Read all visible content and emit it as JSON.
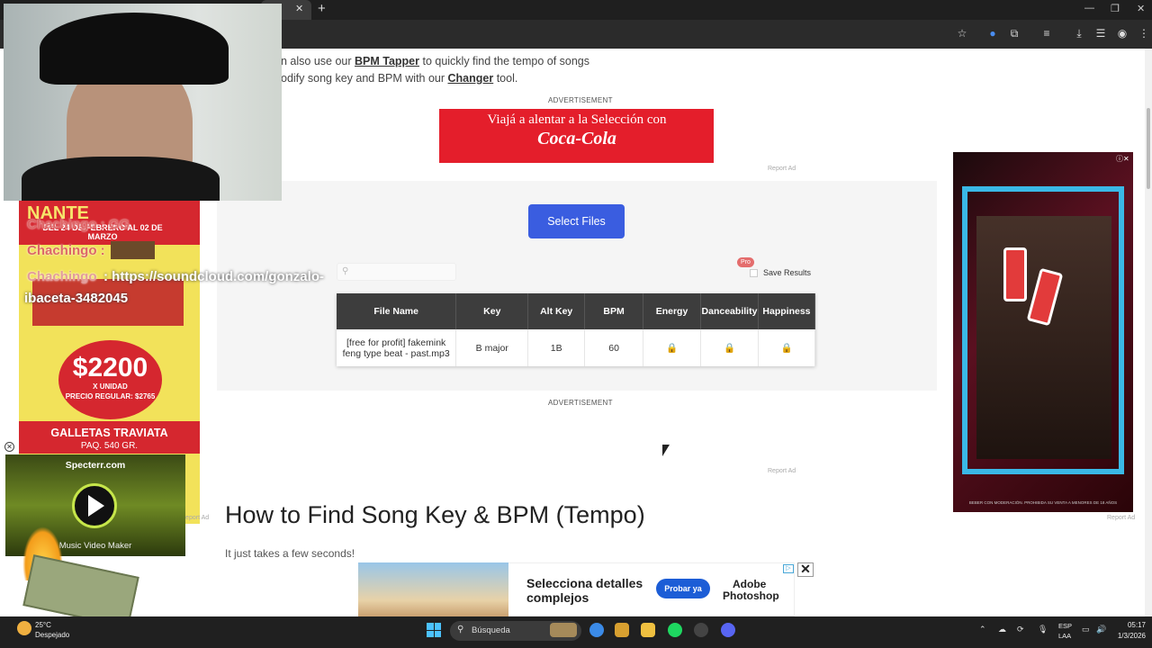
{
  "browser": {
    "tab_close": "✕",
    "new_tab": "+",
    "win_min": "—",
    "win_max": "❐",
    "win_close": "✕"
  },
  "intro": {
    "line1_pre": "n also use our ",
    "line1_link": "BPM Tapper",
    "line1_post": " to quickly find the tempo of songs",
    "line2_pre": "odify song key and BPM with our ",
    "line2_link": "Changer",
    "line2_post": " tool."
  },
  "ads": {
    "label_top": "ADVERTISEMENT",
    "label_mid": "ADVERTISEMENT",
    "report_ad": "Report Ad",
    "coke_headline": "Viajá a alentar a la Selección con",
    "coke_brand": "Coca-Cola",
    "left_nante": "NANTE",
    "left_dates": "DEL 24 DE FEBRERO AL 02 DE MARZO",
    "left_price": "$2200",
    "left_unidad": "X UNIDAD",
    "left_precio_regular": "PRECIO REGULAR: $2765",
    "left_product": "GALLETAS TRAVIATA",
    "left_pack": "PAQ. 540 GR.",
    "right_footer": "BEBER CON MODERACIÓN. PROHIBIDA SU VENTA A MENORES DE 18 AÑOS",
    "bottom_line1": "Selecciona detalles",
    "bottom_line2": "complejos",
    "bottom_cta": "Probar ya",
    "bottom_brand1": "Adobe",
    "bottom_brand2": "Photoshop",
    "close": "✕"
  },
  "tool": {
    "select_files": "Select Files",
    "pro_badge": "Pro",
    "save_results": "Save Results",
    "columns": [
      "File Name",
      "Key",
      "Alt Key",
      "BPM",
      "Energy",
      "Danceability",
      "Happiness"
    ],
    "row": {
      "file_name": "[free for profit] fakemink feng type beat - past.mp3",
      "key": "B major",
      "alt_key": "1B",
      "bpm": "60"
    },
    "lock_glyph": "🔒"
  },
  "content": {
    "heading": "How to Find Song Key & BPM (Tempo)",
    "subtext": "It just takes a few seconds!"
  },
  "overlay": {
    "chat_name_1": "Chachingo : GG",
    "chat_name_2": "Chachingo :",
    "chat_name_3": "Chachingo",
    "chat_msg": ": https://soundcloud.com/gonzalo-",
    "chat_msg_2": "ibaceta-3482045",
    "specterr_title": "Specterr.com",
    "specterr_sub": "Music Video Maker"
  },
  "taskbar": {
    "weather_temp": "25°C",
    "weather_desc": "Despejado",
    "search_placeholder": "Búsqueda",
    "lang1": "ESP",
    "lang2": "LAA",
    "time": "05:17",
    "date": "1/3/2026"
  }
}
